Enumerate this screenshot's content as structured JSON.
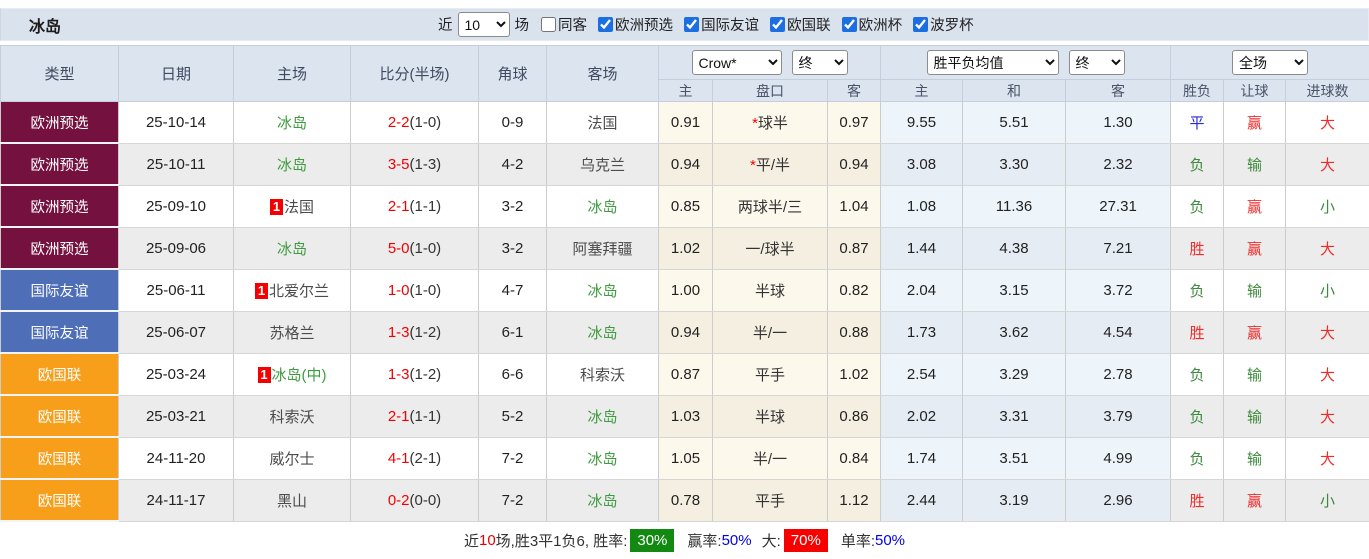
{
  "title": "冰岛",
  "controls": {
    "recent_label": "近",
    "recent_value": "10",
    "games_label": "场",
    "filters": [
      {
        "label": "同客",
        "checked": false
      },
      {
        "label": "欧洲预选",
        "checked": true
      },
      {
        "label": "国际友谊",
        "checked": true
      },
      {
        "label": "欧国联",
        "checked": true
      },
      {
        "label": "欧洲杯",
        "checked": true
      },
      {
        "label": "波罗杯",
        "checked": true
      }
    ]
  },
  "table": {
    "headers": {
      "type": "类型",
      "date": "日期",
      "home": "主场",
      "score": "比分(半场)",
      "corner": "角球",
      "away": "客场",
      "crow_select": "Crow*",
      "crow_final_select": "终",
      "avg_select": "胜平负均值",
      "avg_final_select": "终",
      "scope_select": "全场",
      "sub": {
        "crow_home": "主",
        "crow_handicap": "盘口",
        "crow_away": "客",
        "avg_home": "主",
        "avg_draw": "和",
        "avg_away": "客",
        "result": "胜负",
        "handicap_result": "让球",
        "goals": "进球数"
      }
    },
    "rows": [
      {
        "league": "欧洲预选",
        "date": "25-10-14",
        "home": "冰岛",
        "home_red": "",
        "score_ft": "2-2",
        "score_ht": "(1-0)",
        "corner": "0-9",
        "away": "法国",
        "crow_home": "0.91",
        "handicap_star": "*",
        "handicap": "球半",
        "crow_away": "0.97",
        "avg_home": "9.55",
        "avg_draw": "5.51",
        "avg_away": "1.30",
        "result": "平",
        "handicap_result": "赢",
        "goals": "大"
      },
      {
        "league": "欧洲预选",
        "date": "25-10-11",
        "home": "冰岛",
        "home_red": "",
        "score_ft": "3-5",
        "score_ht": "(1-3)",
        "corner": "4-2",
        "away": "乌克兰",
        "crow_home": "0.94",
        "handicap_star": "*",
        "handicap": "平/半",
        "crow_away": "0.94",
        "avg_home": "3.08",
        "avg_draw": "3.30",
        "avg_away": "2.32",
        "result": "负",
        "handicap_result": "输",
        "goals": "大"
      },
      {
        "league": "欧洲预选",
        "date": "25-09-10",
        "home": "法国",
        "home_red": "1",
        "score_ft": "2-1",
        "score_ht": "(1-1)",
        "corner": "3-2",
        "away": "冰岛",
        "crow_home": "0.85",
        "handicap_star": "",
        "handicap": "两球半/三",
        "crow_away": "1.04",
        "avg_home": "1.08",
        "avg_draw": "11.36",
        "avg_away": "27.31",
        "result": "负",
        "handicap_result": "赢",
        "goals": "小"
      },
      {
        "league": "欧洲预选",
        "date": "25-09-06",
        "home": "冰岛",
        "home_red": "",
        "score_ft": "5-0",
        "score_ht": "(1-0)",
        "corner": "3-2",
        "away": "阿塞拜疆",
        "crow_home": "1.02",
        "handicap_star": "",
        "handicap": "一/球半",
        "crow_away": "0.87",
        "avg_home": "1.44",
        "avg_draw": "4.38",
        "avg_away": "7.21",
        "result": "胜",
        "handicap_result": "赢",
        "goals": "大"
      },
      {
        "league": "国际友谊",
        "date": "25-06-11",
        "home": "北爱尔兰",
        "home_red": "1",
        "score_ft": "1-0",
        "score_ht": "(1-0)",
        "corner": "4-7",
        "away": "冰岛",
        "crow_home": "1.00",
        "handicap_star": "",
        "handicap": "半球",
        "crow_away": "0.82",
        "avg_home": "2.04",
        "avg_draw": "3.15",
        "avg_away": "3.72",
        "result": "负",
        "handicap_result": "输",
        "goals": "小"
      },
      {
        "league": "国际友谊",
        "date": "25-06-07",
        "home": "苏格兰",
        "home_red": "",
        "score_ft": "1-3",
        "score_ht": "(1-2)",
        "corner": "6-1",
        "away": "冰岛",
        "crow_home": "0.94",
        "handicap_star": "",
        "handicap": "半/一",
        "crow_away": "0.88",
        "avg_home": "1.73",
        "avg_draw": "3.62",
        "avg_away": "4.54",
        "result": "胜",
        "handicap_result": "赢",
        "goals": "大"
      },
      {
        "league": "欧国联",
        "date": "25-03-24",
        "home": "冰岛(中)",
        "home_red": "1",
        "score_ft": "1-3",
        "score_ht": "(1-2)",
        "corner": "6-6",
        "away": "科索沃",
        "crow_home": "0.87",
        "handicap_star": "",
        "handicap": "平手",
        "crow_away": "1.02",
        "avg_home": "2.54",
        "avg_draw": "3.29",
        "avg_away": "2.78",
        "result": "负",
        "handicap_result": "输",
        "goals": "大"
      },
      {
        "league": "欧国联",
        "date": "25-03-21",
        "home": "科索沃",
        "home_red": "",
        "score_ft": "2-1",
        "score_ht": "(1-1)",
        "corner": "5-2",
        "away": "冰岛",
        "crow_home": "1.03",
        "handicap_star": "",
        "handicap": "半球",
        "crow_away": "0.86",
        "avg_home": "2.02",
        "avg_draw": "3.31",
        "avg_away": "3.79",
        "result": "负",
        "handicap_result": "输",
        "goals": "大"
      },
      {
        "league": "欧国联",
        "date": "24-11-20",
        "home": "威尔士",
        "home_red": "",
        "score_ft": "4-1",
        "score_ht": "(2-1)",
        "corner": "7-2",
        "away": "冰岛",
        "crow_home": "1.05",
        "handicap_star": "",
        "handicap": "半/一",
        "crow_away": "0.84",
        "avg_home": "1.74",
        "avg_draw": "3.51",
        "avg_away": "4.99",
        "result": "负",
        "handicap_result": "输",
        "goals": "大"
      },
      {
        "league": "欧国联",
        "date": "24-11-17",
        "home": "黑山",
        "home_red": "",
        "score_ft": "0-2",
        "score_ht": "(0-0)",
        "corner": "7-2",
        "away": "冰岛",
        "crow_home": "0.78",
        "handicap_star": "",
        "handicap": "平手",
        "crow_away": "1.12",
        "avg_home": "2.44",
        "avg_draw": "3.19",
        "avg_away": "2.96",
        "result": "胜",
        "handicap_result": "赢",
        "goals": "小"
      }
    ]
  },
  "summary": {
    "p1": "近",
    "games": "10",
    "p2": "场,胜3平1负6, 胜率:",
    "win_rate": "30%",
    "p3": "赢率:",
    "win_rate2": "50%",
    "p4": "大:",
    "big_rate": "70%",
    "p5": "单率:",
    "single_rate": "50%"
  },
  "colors": {
    "leagues": {
      "欧洲预选": "#75113F",
      "国际友谊": "#4E6EB8",
      "欧国联": "#F79F1A"
    },
    "result_red": "#ef2b2b",
    "result_green": "#3c8a3c",
    "result_blue": "#2727d8",
    "score_red": "#f40000",
    "focus_team_green": "#3f9b3f",
    "summary_green_bg": "#128a12",
    "summary_red_bg": "#f60000"
  }
}
